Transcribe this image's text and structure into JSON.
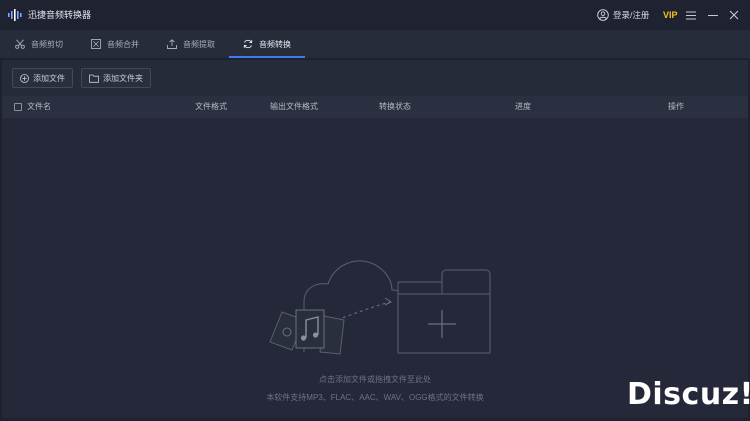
{
  "app": {
    "title": "迅捷音频转换器"
  },
  "header": {
    "login_label": "登录/注册",
    "vip_label": "VIP"
  },
  "tabs": [
    {
      "label": "音频剪切",
      "icon": "scissors-icon"
    },
    {
      "label": "音频合并",
      "icon": "merge-icon"
    },
    {
      "label": "音频提取",
      "icon": "extract-icon"
    },
    {
      "label": "音频转换",
      "icon": "convert-icon",
      "active": true
    }
  ],
  "toolbar": {
    "add_file_label": "添加文件",
    "add_folder_label": "添加文件夹"
  },
  "table": {
    "columns": [
      "文件名",
      "文件格式",
      "输出文件格式",
      "转换状态",
      "进度",
      "操作"
    ]
  },
  "empty_state": {
    "hint_primary": "点击添加文件或拖拽文件至此处",
    "hint_secondary": "本软件支持MP3、FLAC、AAC、WAV、OGG格式的文件转换"
  },
  "watermark": {
    "text": "Discuz!"
  },
  "colors": {
    "accent": "#3d7df0",
    "vip": "#f5c518",
    "background": "#1e2230"
  }
}
